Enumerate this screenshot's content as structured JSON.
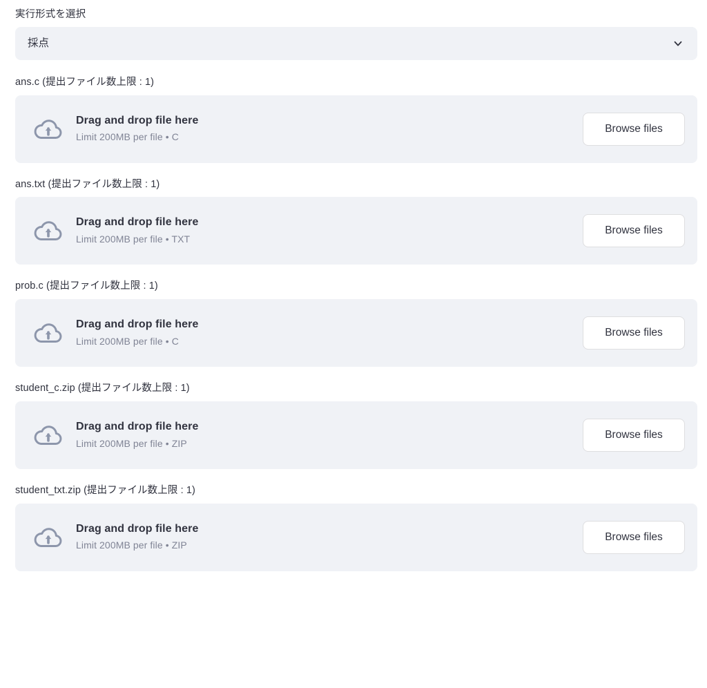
{
  "select_widget": {
    "label": "実行形式を選択",
    "selected_value": "採点",
    "chevron_icon": "chevron-down-icon",
    "background_color": "#f0f2f6"
  },
  "uploaders": [
    {
      "label": "ans.c (提出ファイル数上限 : 1)",
      "icon": "cloud-upload-icon",
      "drag_text": "Drag and drop file here",
      "limit_text": "Limit 200MB per file • C",
      "button_label": "Browse files"
    },
    {
      "label": "ans.txt (提出ファイル数上限 : 1)",
      "icon": "cloud-upload-icon",
      "drag_text": "Drag and drop file here",
      "limit_text": "Limit 200MB per file • TXT",
      "button_label": "Browse files"
    },
    {
      "label": "prob.c (提出ファイル数上限 : 1)",
      "icon": "cloud-upload-icon",
      "drag_text": "Drag and drop file here",
      "limit_text": "Limit 200MB per file • C",
      "button_label": "Browse files"
    },
    {
      "label": "student_c.zip (提出ファイル数上限 : 1)",
      "icon": "cloud-upload-icon",
      "drag_text": "Drag and drop file here",
      "limit_text": "Limit 200MB per file • ZIP",
      "button_label": "Browse files"
    },
    {
      "label": "student_txt.zip (提出ファイル数上限 : 1)",
      "icon": "cloud-upload-icon",
      "drag_text": "Drag and drop file here",
      "limit_text": "Limit 200MB per file • ZIP",
      "button_label": "Browse files"
    }
  ],
  "colors": {
    "page_background": "#ffffff",
    "widget_background": "#f0f2f6",
    "text_primary": "#31333f",
    "text_secondary": "#808495",
    "icon_color": "#8d96ab",
    "button_background": "#ffffff",
    "button_border": "rgba(49, 51, 63, 0.16)"
  }
}
